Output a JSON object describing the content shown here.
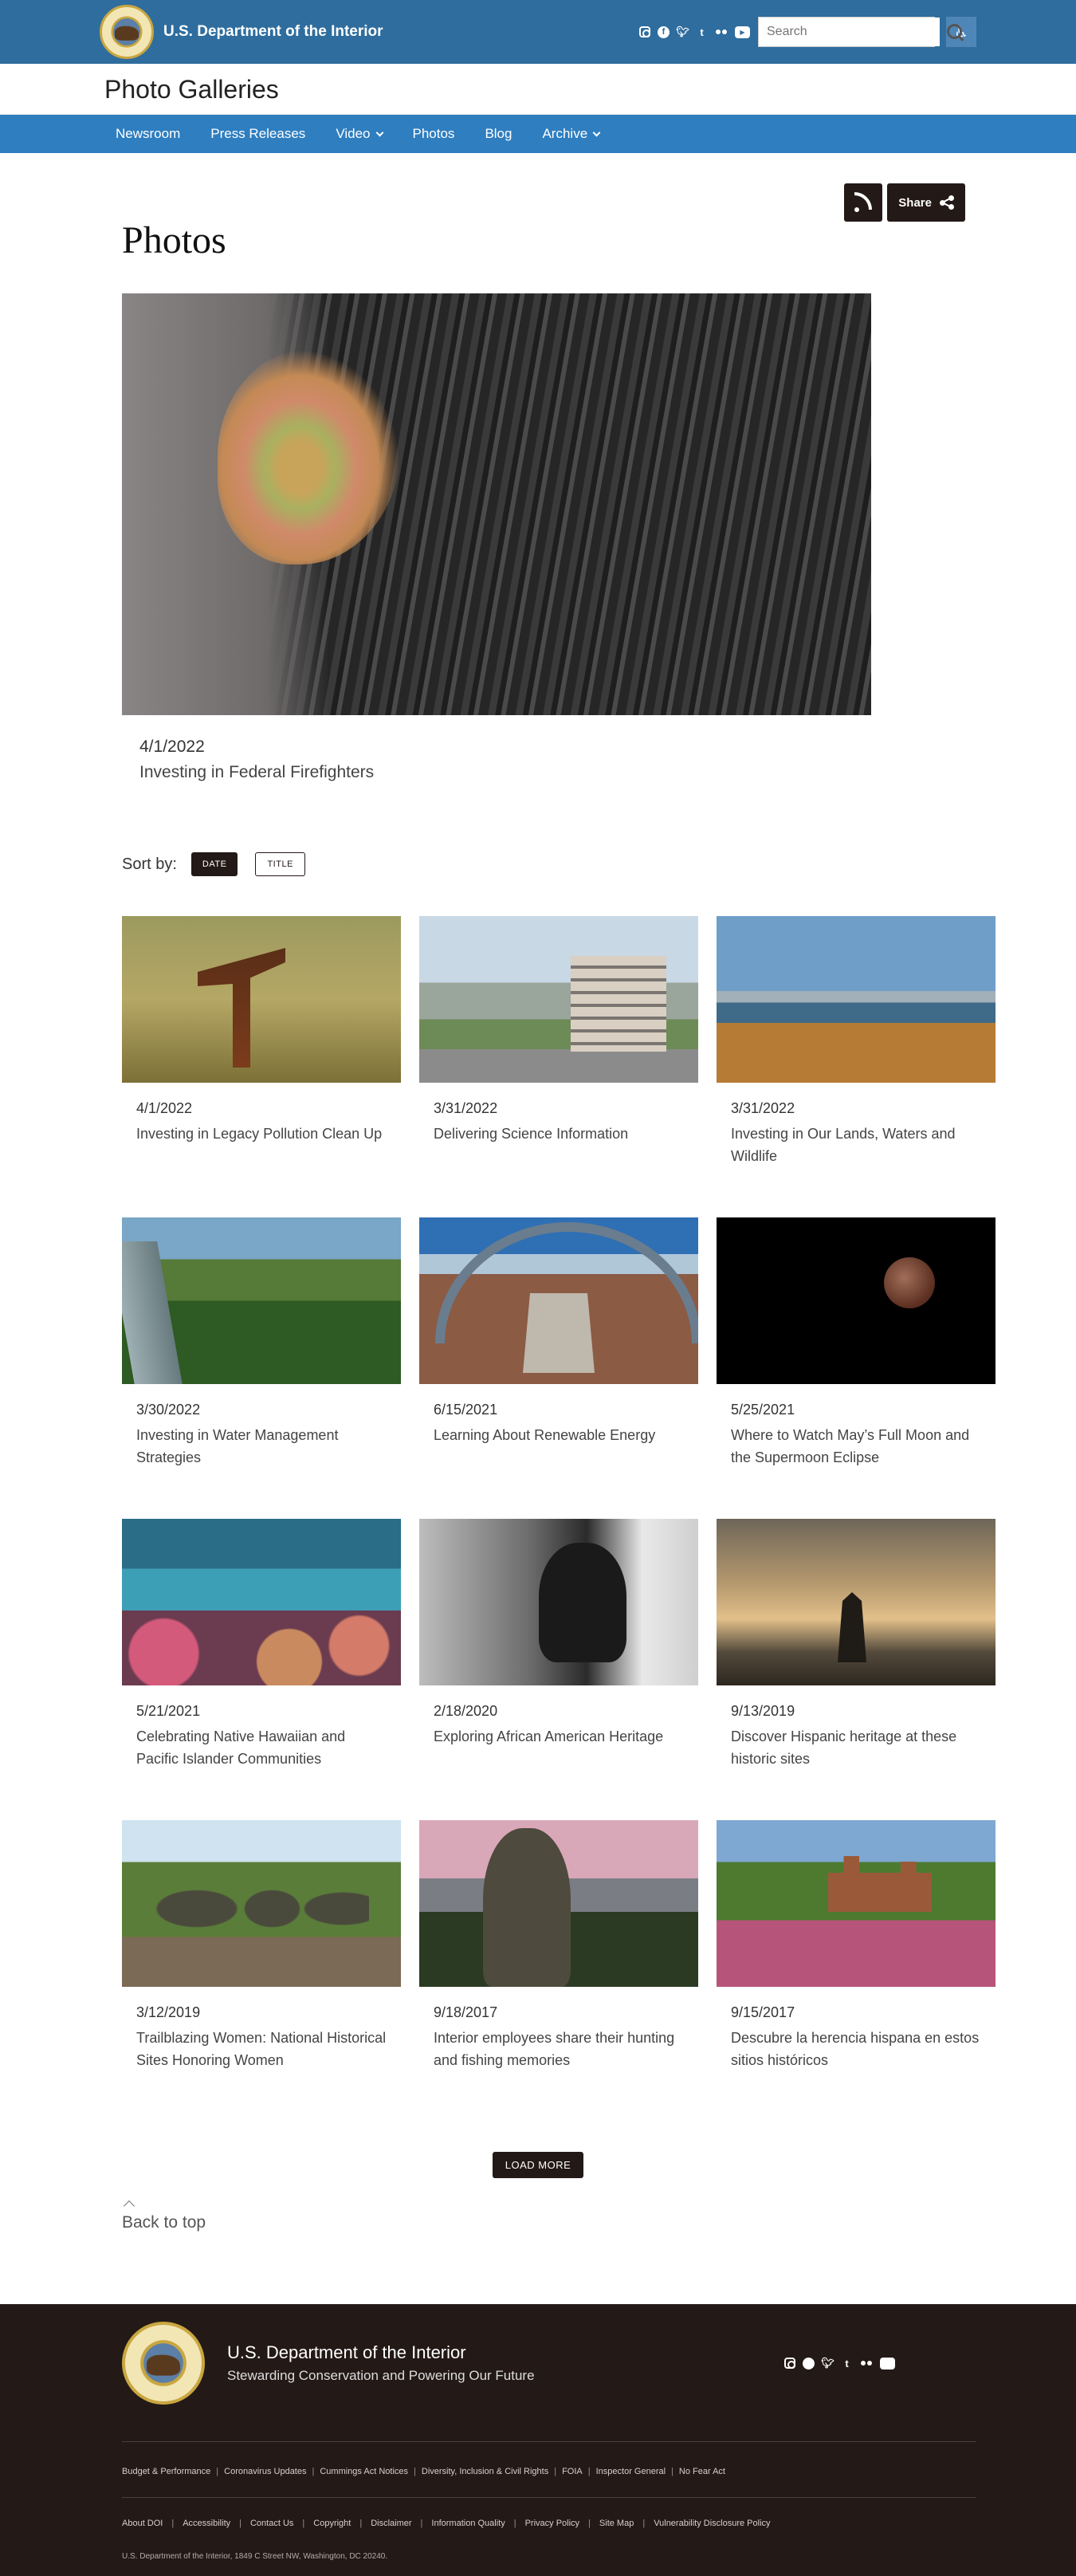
{
  "header": {
    "brand_name": "U.S. Department of the Interior",
    "search_placeholder": "Search",
    "social": [
      "instagram-icon",
      "facebook-icon",
      "twitter-icon",
      "tumblr-icon",
      "flickr-icon",
      "youtube-icon"
    ],
    "accessibility_icon": "accessibility-icon"
  },
  "section_title": "Photo Galleries",
  "nav": {
    "items": [
      {
        "label": "Newsroom",
        "dropdown": false
      },
      {
        "label": "Press Releases",
        "dropdown": false
      },
      {
        "label": "Video",
        "dropdown": true
      },
      {
        "label": "Photos",
        "dropdown": false
      },
      {
        "label": "Blog",
        "dropdown": false
      },
      {
        "label": "Archive",
        "dropdown": true
      }
    ]
  },
  "tools": {
    "share_label": "Share"
  },
  "page_title": "Photos",
  "featured": {
    "date": "4/1/2022",
    "title": "Investing in Federal Firefighters"
  },
  "sort": {
    "label": "Sort by:",
    "options": [
      "DATE",
      "TITLE"
    ],
    "active": "DATE"
  },
  "gallery": [
    {
      "date": "4/1/2022",
      "title": "Investing in Legacy Pollution Clean Up"
    },
    {
      "date": "3/31/2022",
      "title": "Delivering Science Information"
    },
    {
      "date": "3/31/2022",
      "title": "Investing in Our Lands, Waters and Wildlife"
    },
    {
      "date": "3/30/2022",
      "title": "Investing in Water Management Strategies"
    },
    {
      "date": "6/15/2021",
      "title": "Learning About Renewable Energy"
    },
    {
      "date": "5/25/2021",
      "title": "Where to Watch May’s Full Moon and the Supermoon Eclipse"
    },
    {
      "date": "5/21/2021",
      "title": "Celebrating Native Hawaiian and Pacific Islander Communities"
    },
    {
      "date": "2/18/2020",
      "title": "Exploring African American Heritage"
    },
    {
      "date": "9/13/2019",
      "title": "Discover Hispanic heritage at these historic sites"
    },
    {
      "date": "3/12/2019",
      "title": "Trailblazing Women: National Historical Sites Honoring Women"
    },
    {
      "date": "9/18/2017",
      "title": "Interior employees share their hunting and fishing memories"
    },
    {
      "date": "9/15/2017",
      "title": "Descubre la herencia hispana en estos sitios históricos"
    }
  ],
  "load_more": "LOAD MORE",
  "back_to_top": "Back to top",
  "footer": {
    "name": "U.S. Department of the Interior",
    "tagline": "Stewarding Conservation and Powering Our Future",
    "links_row1": [
      "Budget & Performance",
      "Coronavirus Updates",
      "Cummings Act Notices",
      "Diversity, Inclusion & Civil Rights",
      "FOIA",
      "Inspector General",
      "No Fear Act"
    ],
    "links_row2": [
      "About DOI",
      "Accessibility",
      "Contact Us",
      "Copyright",
      "Disclaimer",
      "Information Quality",
      "Privacy Policy",
      "Site Map",
      "Vulnerability Disclosure Policy"
    ],
    "address": "U.S. Department of the Interior, 1849 C Street NW, Washington, DC 20240."
  },
  "colors": {
    "header_bg": "#2e6d9e",
    "nav_bg": "#2e7ec0",
    "dark": "#231916"
  }
}
